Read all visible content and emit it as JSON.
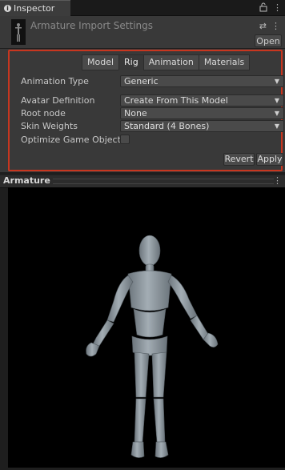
{
  "window": {
    "tab_title": "Inspector",
    "tab_icon": "info-icon",
    "window_icons": [
      "lock-icon",
      "kebab-menu-icon"
    ]
  },
  "header": {
    "title": "Armature Import Settings",
    "open_label": "Open",
    "icons": [
      "preset-icon",
      "kebab-menu-icon"
    ]
  },
  "tabs": [
    {
      "label": "Model",
      "active": false
    },
    {
      "label": "Rig",
      "active": true
    },
    {
      "label": "Animation",
      "active": false
    },
    {
      "label": "Materials",
      "active": false
    }
  ],
  "fields": {
    "animation_type": {
      "label": "Animation Type",
      "value": "Generic"
    },
    "avatar_definition": {
      "label": "Avatar Definition",
      "value": "Create From This Model"
    },
    "root_node": {
      "label": "Root node",
      "value": "None"
    },
    "skin_weights": {
      "label": "Skin Weights",
      "value": "Standard (4 Bones)"
    },
    "optimize_game_objects": {
      "label": "Optimize Game Objects",
      "checked": false
    }
  },
  "buttons": {
    "revert": "Revert",
    "apply": "Apply"
  },
  "preview": {
    "title": "Armature",
    "subject": "humanoid-mannequin"
  },
  "colors": {
    "highlight_border": "#c8361f",
    "panel_bg": "#393939",
    "preview_bg": "#000000",
    "mannequin": "#8c969e"
  }
}
